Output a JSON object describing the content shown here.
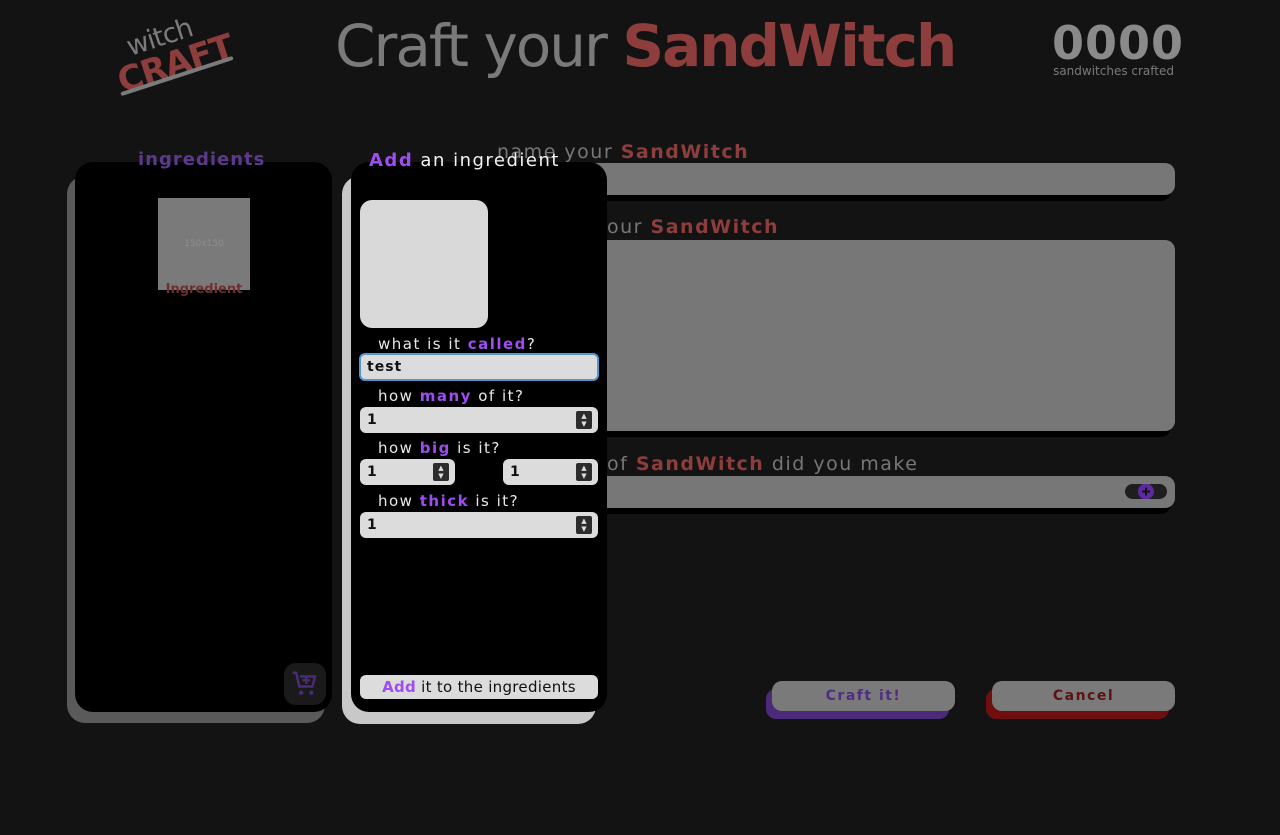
{
  "header": {
    "logo_top": "witch",
    "logo_bottom": "CRAFT",
    "title_prefix": "Craft your ",
    "title_accent": "SandWitch",
    "counter_value": "0000",
    "counter_label": "sandwitches crafted"
  },
  "form": {
    "name_label_prefix": "name your ",
    "name_label_accent": "SandWitch",
    "desc_label_prefix": "our ",
    "desc_label_accent": "SandWitch",
    "type_label_prefix": "of ",
    "type_label_accent": "SandWitch",
    "type_label_suffix": " did you make",
    "craft_button": "Craft it!",
    "cancel_button": "Cancel"
  },
  "ingredients": {
    "title": "ingredients",
    "items": [
      {
        "placeholder": "150x150",
        "name": "Ingredient"
      }
    ]
  },
  "modal": {
    "title_accent": "Add",
    "title_rest": " an ingredient",
    "name_q_prefix": "what is it ",
    "name_q_accent": "called",
    "name_q_suffix": "?",
    "name_value": "test",
    "many_q_prefix": "how ",
    "many_q_accent": "many",
    "many_q_suffix": " of it?",
    "many_value": "1",
    "big_q_prefix": "how ",
    "big_q_accent": "big",
    "big_q_suffix": " is it?",
    "big_value_1": "1",
    "big_value_2": "1",
    "thick_q_prefix": "how ",
    "thick_q_accent": "thick",
    "thick_q_suffix": " is it?",
    "thick_value": "1",
    "add_accent": "Add",
    "add_rest": " it to the ingredients"
  },
  "colors": {
    "purple": "#9d4df0",
    "red": "#8e3d3d",
    "background": "#141314"
  }
}
